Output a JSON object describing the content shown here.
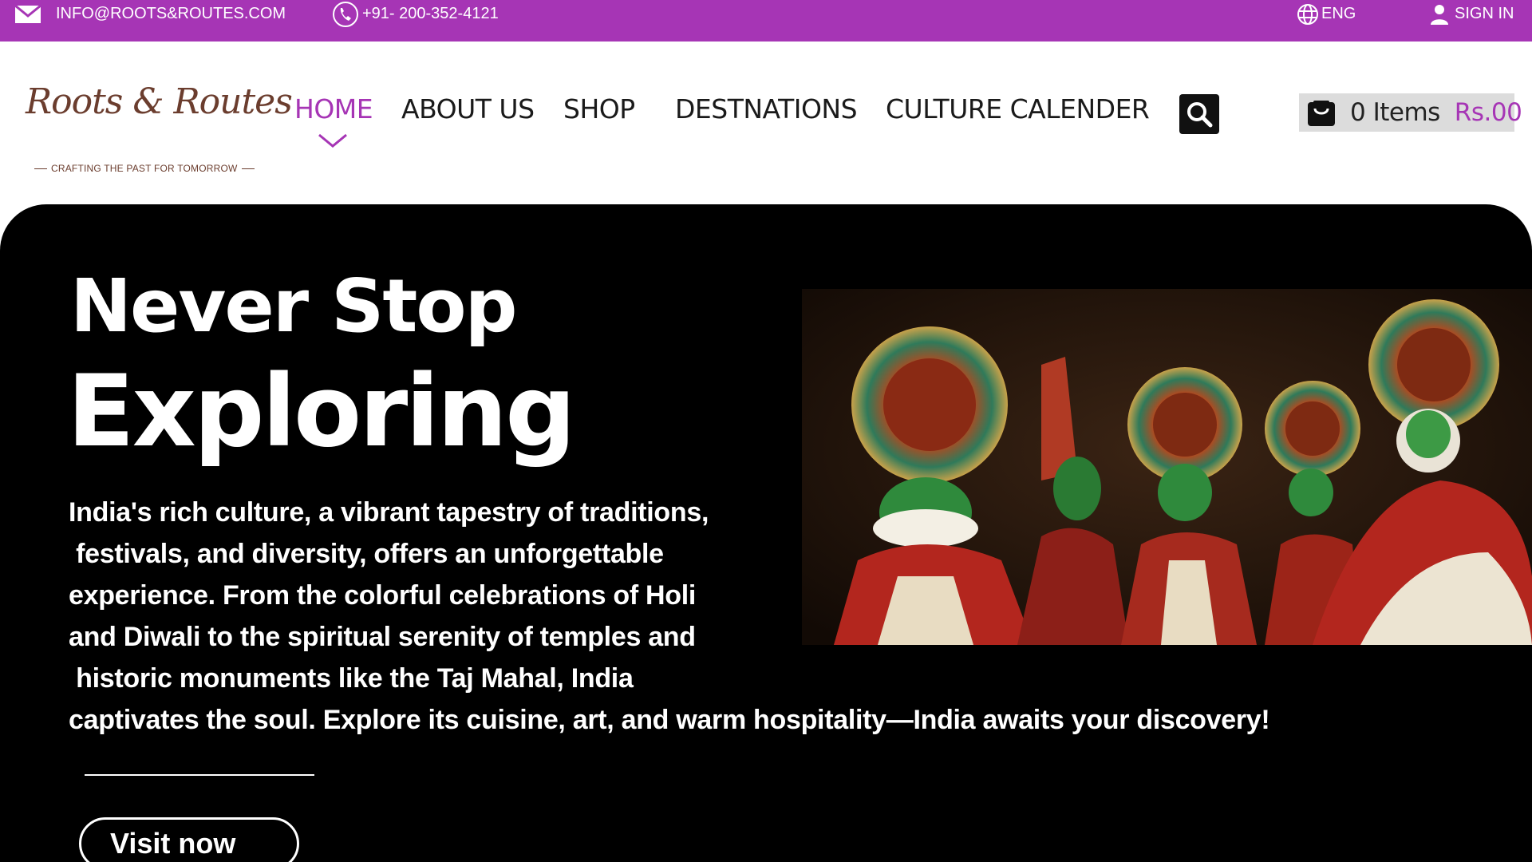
{
  "topbar": {
    "email": "INFO@ROOTS&ROUTES.COM",
    "phone": "+91- 200-352-4121",
    "language": "ENG",
    "signin": "SIGN IN",
    "email_icon": "mail-icon",
    "phone_icon": "phone-icon",
    "language_icon": "globe-icon",
    "signin_icon": "user-icon",
    "bg_color": "#a635b5"
  },
  "logo": {
    "title": "Roots & Routes",
    "tagline": "CRAFTING THE PAST FOR TOMORROW"
  },
  "nav": {
    "items": [
      {
        "label": "HOME",
        "active": true
      },
      {
        "label": "ABOUT US",
        "active": false
      },
      {
        "label": "SHOP",
        "active": false
      },
      {
        "label": "DESTNATIONS",
        "active": false
      },
      {
        "label": "CULTURE CALENDER",
        "active": false
      }
    ],
    "active_color": "#a635b5",
    "search_icon": "search-icon"
  },
  "cart": {
    "count_label": "0 Items",
    "price_label": "Rs.00",
    "icon": "shopping-bag-icon"
  },
  "hero": {
    "title_line1": "Never Stop",
    "title_line2": "Exploring",
    "body_lines": [
      "India's rich culture, a vibrant tapestry of traditions,",
      " festivals, and diversity, offers an unforgettable",
      "experience. From the colorful celebrations of Holi",
      "and Diwali to the spiritual serenity of temples and",
      " historic monuments like the Taj Mahal, India",
      "captivates the soul. Explore its cuisine, art, and warm hospitality—India awaits your discovery!"
    ],
    "cta_label": "Visit now",
    "image_subject": "kathakali-dancers-photo"
  }
}
